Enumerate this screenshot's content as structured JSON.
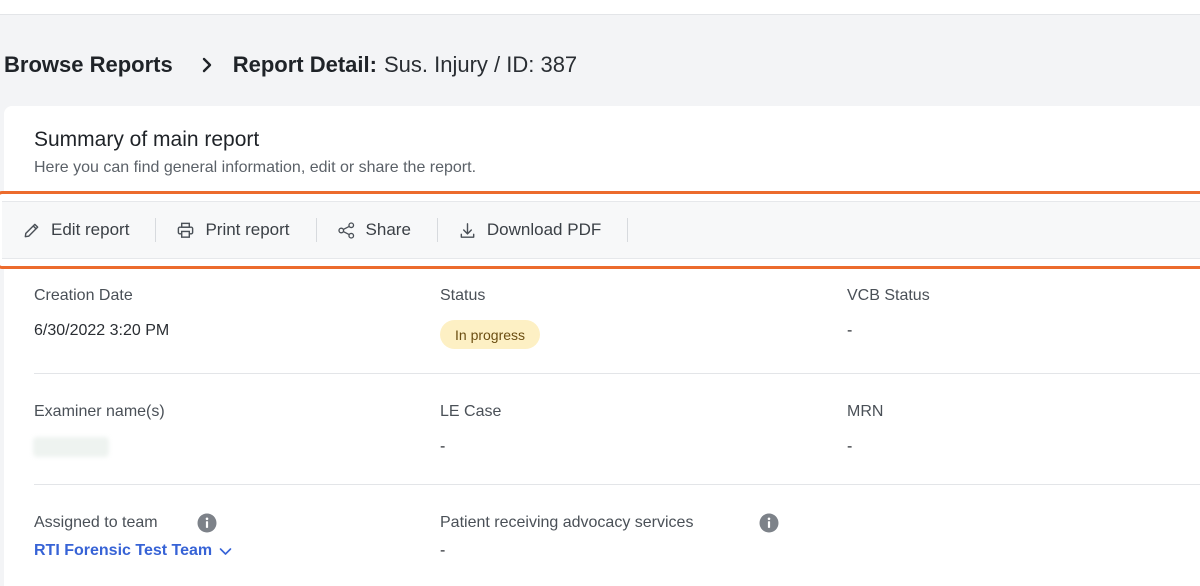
{
  "breadcrumb": {
    "parent": "Browse Reports",
    "current_label": "Report Detail:",
    "current_value": "Sus. Injury / ID: 387"
  },
  "summary": {
    "title": "Summary of main report",
    "subtitle": "Here you can find general information, edit or share the report."
  },
  "toolbar": {
    "edit": "Edit report",
    "print": "Print report",
    "share": "Share",
    "download": "Download PDF"
  },
  "fields": {
    "creation_date": {
      "label": "Creation Date",
      "value": "6/30/2022 3:20 PM"
    },
    "status": {
      "label": "Status",
      "value": "In progress"
    },
    "vcb_status": {
      "label": "VCB Status",
      "value": "-"
    },
    "examiner": {
      "label": "Examiner name(s)"
    },
    "le_case": {
      "label": "LE Case",
      "value": "-"
    },
    "mrn": {
      "label": "MRN",
      "value": "-"
    },
    "assigned_team": {
      "label": "Assigned to team",
      "value": "RTI Forensic Test Team"
    },
    "advocacy": {
      "label": "Patient receiving advocacy services",
      "value": "-"
    }
  },
  "colors": {
    "highlight": "#ec6b2d",
    "link": "#3763d6",
    "badge_bg": "#fdf0c4",
    "badge_text": "#6b4e12"
  },
  "icons": [
    "chevron-right-icon",
    "pencil-icon",
    "printer-icon",
    "share-icon",
    "download-icon",
    "info-icon",
    "chevron-down-icon"
  ]
}
